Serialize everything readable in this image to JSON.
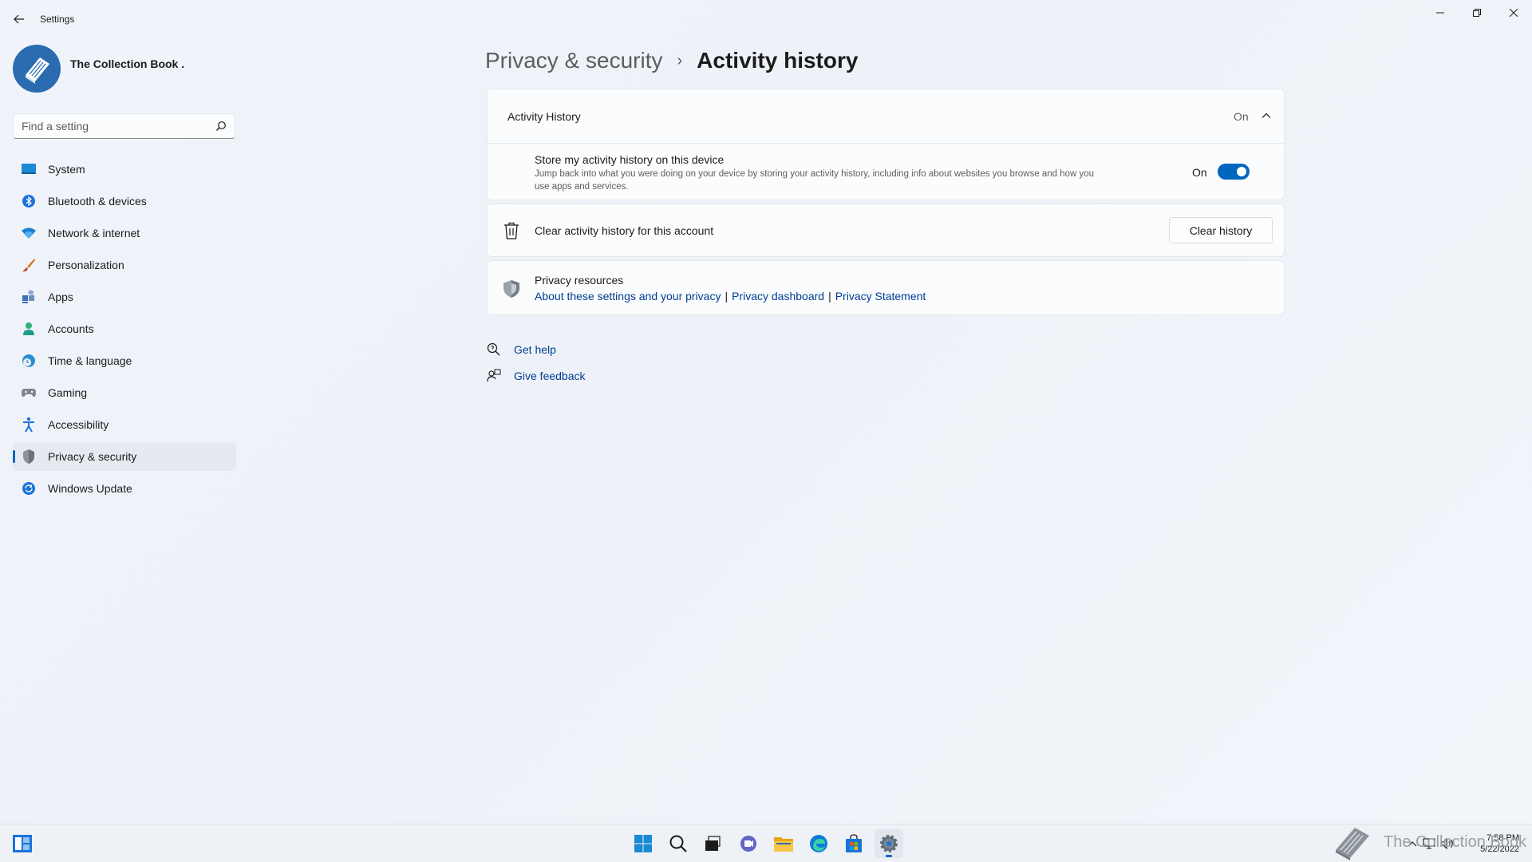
{
  "window": {
    "title": "Settings"
  },
  "profile": {
    "name": "The Collection Book ."
  },
  "search": {
    "placeholder": "Find a setting"
  },
  "sidebar": {
    "items": [
      {
        "label": "System",
        "icon": "system-icon"
      },
      {
        "label": "Bluetooth & devices",
        "icon": "bluetooth-icon"
      },
      {
        "label": "Network & internet",
        "icon": "wifi-icon"
      },
      {
        "label": "Personalization",
        "icon": "brush-icon"
      },
      {
        "label": "Apps",
        "icon": "apps-icon"
      },
      {
        "label": "Accounts",
        "icon": "person-icon"
      },
      {
        "label": "Time & language",
        "icon": "globe-clock-icon"
      },
      {
        "label": "Gaming",
        "icon": "gamepad-icon"
      },
      {
        "label": "Accessibility",
        "icon": "accessibility-icon"
      },
      {
        "label": "Privacy & security",
        "icon": "shield-icon"
      },
      {
        "label": "Windows Update",
        "icon": "update-icon"
      }
    ],
    "active_index": 9
  },
  "breadcrumb": {
    "parent": "Privacy & security",
    "separator": "›",
    "current": "Activity history"
  },
  "activity": {
    "header_title": "Activity History",
    "header_state": "On",
    "setting_title": "Store my activity history on this device",
    "setting_desc": "Jump back into what you were doing on your device by storing your activity history, including info about websites you browse and how you use apps and services.",
    "toggle_state": "On",
    "toggle_on": true
  },
  "clear": {
    "label": "Clear activity history for this account",
    "button": "Clear history"
  },
  "privacy": {
    "title": "Privacy resources",
    "link1": "About these settings and your privacy",
    "link2": "Privacy dashboard",
    "link3": "Privacy Statement",
    "pipe": "|"
  },
  "help": {
    "get_help": "Get help",
    "give_feedback": "Give feedback"
  },
  "taskbar": {
    "icons": [
      "widgets-icon",
      "start-icon",
      "search-icon",
      "task-view-icon",
      "chat-icon",
      "file-explorer-icon",
      "edge-icon",
      "store-icon",
      "settings-icon"
    ],
    "time": "7:58 PM",
    "date": "5/22/2022"
  },
  "watermark": {
    "text": "The Collection Book"
  },
  "colors": {
    "accent": "#0067c0",
    "link": "#003e92",
    "background": "#f0f4fa"
  }
}
